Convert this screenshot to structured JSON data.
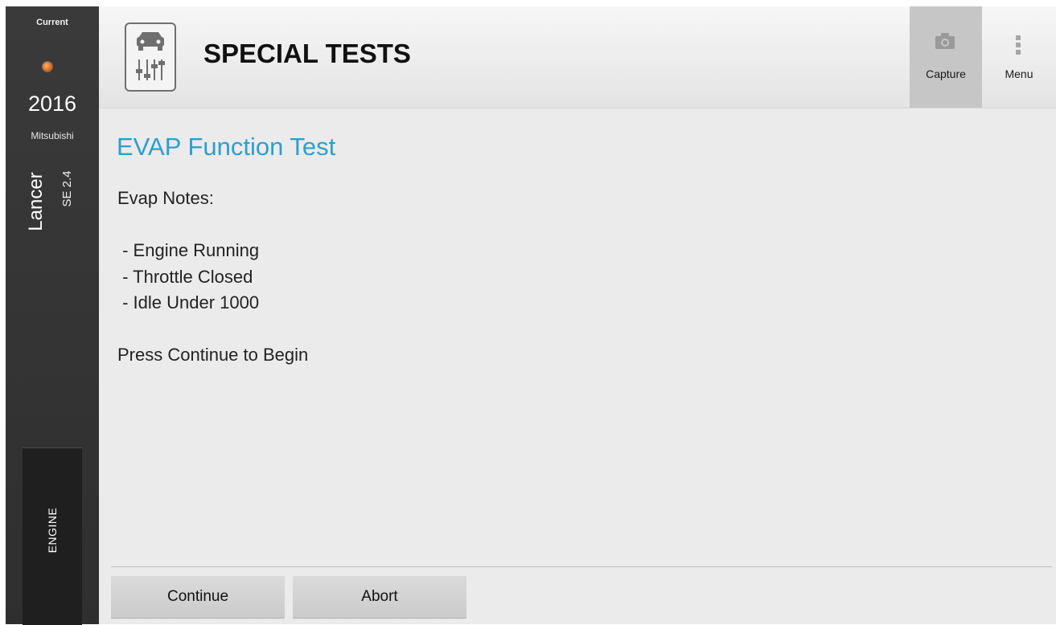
{
  "sidebar": {
    "current_label": "Current",
    "year": "2016",
    "make": "Mitsubishi",
    "model": "Lancer",
    "trim": "SE 2.4",
    "system": "ENGINE"
  },
  "header": {
    "title": "SPECIAL TESTS",
    "capture_label": "Capture",
    "menu_label": "Menu"
  },
  "main": {
    "title": "EVAP Function Test",
    "notes_heading": "Evap Notes:",
    "notes": [
      " - Engine Running",
      " - Throttle Closed",
      " - Idle Under 1000"
    ],
    "prompt": "Press Continue to Begin"
  },
  "buttons": {
    "continue_label": "Continue",
    "abort_label": "Abort"
  },
  "colors": {
    "accent": "#2d9fcf",
    "sidebar": "#333333",
    "status_dot": "#e06a1a"
  }
}
